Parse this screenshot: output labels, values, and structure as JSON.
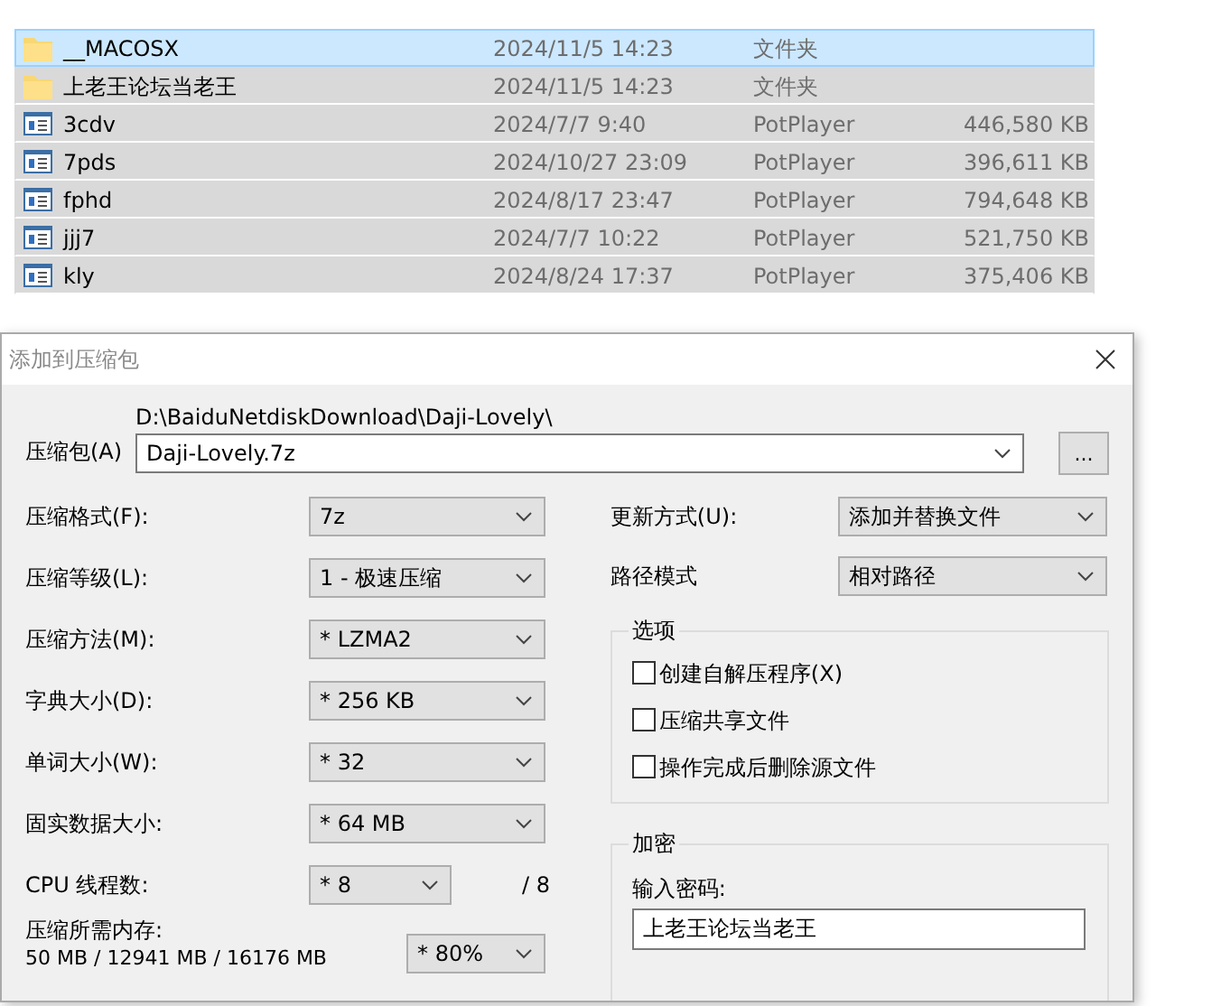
{
  "files": [
    {
      "name": "__MACOSX",
      "date": "2024/11/5 14:23",
      "type": "文件夹",
      "kind": "folder",
      "selected": true,
      "focused": true
    },
    {
      "name": "上老王论坛当老王",
      "date": "2024/11/5 14:23",
      "type": "文件夹",
      "kind": "folder",
      "selected": true,
      "focused": false
    },
    {
      "name": "3cdv",
      "date": "2024/7/7 9:40",
      "type": "PotPlayer",
      "size": "446,580 KB",
      "kind": "media",
      "selected": true,
      "focused": false
    },
    {
      "name": "7pds",
      "date": "2024/10/27 23:09",
      "type": "PotPlayer",
      "size": "396,611 KB",
      "kind": "media",
      "selected": true,
      "focused": false
    },
    {
      "name": "fphd",
      "date": "2024/8/17 23:47",
      "type": "PotPlayer",
      "size": "794,648 KB",
      "kind": "media",
      "selected": true,
      "focused": false
    },
    {
      "name": "jjj7",
      "date": "2024/7/7 10:22",
      "type": "PotPlayer",
      "size": "521,750 KB",
      "kind": "media",
      "selected": true,
      "focused": false
    },
    {
      "name": "kly",
      "date": "2024/8/24 17:37",
      "type": "PotPlayer",
      "size": "375,406 KB",
      "kind": "media",
      "selected": true,
      "focused": false
    }
  ],
  "dialog": {
    "title": "添加到压缩包",
    "archive": {
      "label": "压缩包(A)",
      "path": "D:\\BaiduNetdiskDownload\\Daji-Lovely\\",
      "value": "Daji-Lovely.7z",
      "browse_button": "..."
    },
    "left_fields": [
      {
        "label": "压缩格式(F):",
        "value": "7z"
      },
      {
        "label": "压缩等级(L):",
        "value": "1 - 极速压缩"
      },
      {
        "label": "压缩方法(M):",
        "value": "* LZMA2"
      },
      {
        "label": "字典大小(D):",
        "value": "* 256 KB"
      },
      {
        "label": "单词大小(W):",
        "value": "* 32"
      },
      {
        "label": "固实数据大小:",
        "value": "* 64 MB"
      }
    ],
    "cpu": {
      "label": "CPU 线程数:",
      "value": "* 8",
      "total": "/ 8"
    },
    "memory": {
      "label": "压缩所需内存:",
      "detail": "50 MB / 12941 MB / 16176 MB",
      "value": "* 80%"
    },
    "right_fields": [
      {
        "label": "更新方式(U):",
        "value": "添加并替换文件"
      },
      {
        "label": "路径模式",
        "value": "相对路径"
      }
    ],
    "options": {
      "title": "选项",
      "items": [
        {
          "label": "创建自解压程序(X)",
          "checked": false
        },
        {
          "label": "压缩共享文件",
          "checked": false
        },
        {
          "label": "操作完成后删除源文件",
          "checked": false
        }
      ]
    },
    "encryption": {
      "title": "加密",
      "label": "输入密码:",
      "value": "上老王论坛当老王"
    }
  }
}
